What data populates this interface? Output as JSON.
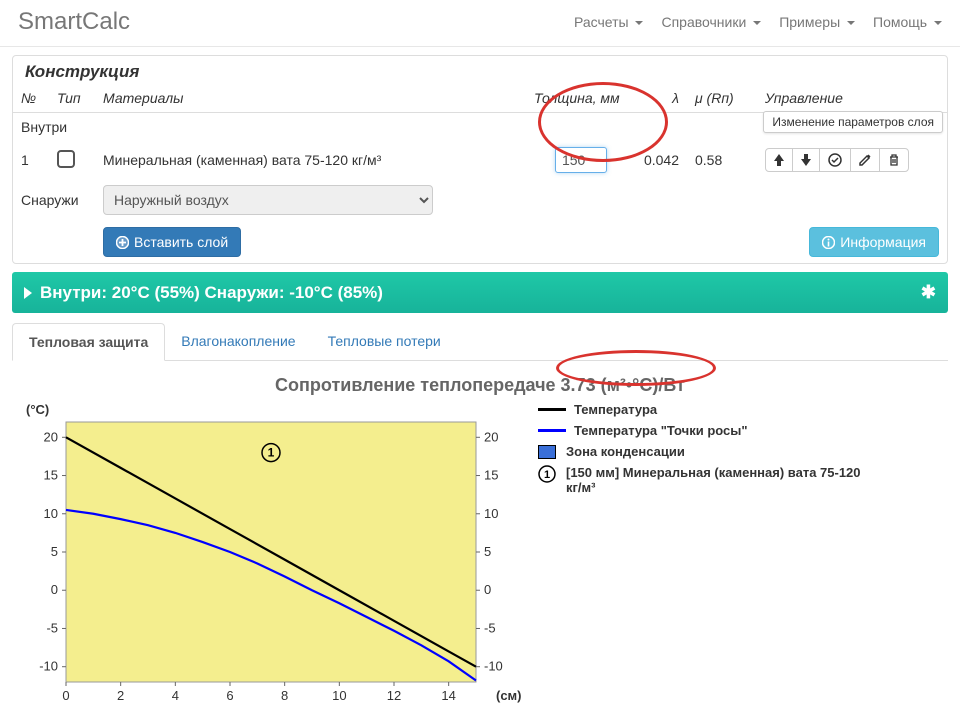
{
  "brand": "SmartCalc",
  "nav": {
    "calc": "Расчеты",
    "ref": "Справочники",
    "ex": "Примеры",
    "help": "Помощь"
  },
  "section_title": "Конструкция",
  "columns": {
    "no": "№",
    "type": "Тип",
    "materials": "Материалы",
    "thickness": "Толщина, мм",
    "lambda": "λ",
    "mu": "μ (Rп)",
    "ctrl": "Управление"
  },
  "inner_label": "Внутри",
  "outer_label": "Снаружи",
  "row1": {
    "no": "1",
    "material": "Минеральная (каменная) вата 75-120 кг/м³",
    "thickness": "150",
    "lambda": "0.042",
    "mu": "0.58"
  },
  "outer_select": "Наружный воздух",
  "btn_insert": "Вставить слой",
  "btn_info": "Информация",
  "tooltip_change": "Изменение параметров слоя",
  "env_text": "Внутри: 20°C (55%) Снаружи: -10°C (85%)",
  "tabs": {
    "t1": "Тепловая защита",
    "t2": "Влагонакопление",
    "t3": "Тепловые потери"
  },
  "chart_title_prefix": "Сопротивление теплопередаче ",
  "chart_title_value": "3.73 (м²•°C)/Вт",
  "axis_y_label": "(°C)",
  "axis_x_label": "(см)",
  "legend": {
    "temp": "Температура",
    "dew": "Температура \"Точки росы\"",
    "cond": "Зона конденсации",
    "layer1": "[150 мм] Минеральная (каменная) вата 75-120 кг/м³"
  },
  "chart_data": {
    "type": "line",
    "xlabel": "(см)",
    "ylabel": "(°C)",
    "xlim": [
      0,
      15
    ],
    "ylim": [
      -12,
      22
    ],
    "x_ticks": [
      0,
      2,
      4,
      6,
      8,
      10,
      12,
      14
    ],
    "y_ticks": [
      -10,
      -5,
      0,
      5,
      10,
      15,
      20
    ],
    "series": [
      {
        "name": "Температура",
        "color": "#000000",
        "x": [
          0,
          2,
          4,
          6,
          8,
          10,
          12,
          14,
          15
        ],
        "y": [
          20,
          16,
          12,
          8,
          4,
          0,
          -4,
          -8,
          -10
        ]
      },
      {
        "name": "Температура \"Точки росы\"",
        "color": "#0000ff",
        "x": [
          0,
          1,
          2,
          3,
          4,
          5,
          6,
          7,
          8,
          9,
          10,
          11,
          12,
          13,
          14,
          15
        ],
        "y": [
          10.5,
          10,
          9.3,
          8.5,
          7.5,
          6.3,
          5,
          3.5,
          1.8,
          0,
          -1.7,
          -3.5,
          -5.3,
          -7.2,
          -9.3,
          -11.8
        ]
      }
    ],
    "layer_region": {
      "x0": 0,
      "x1": 15,
      "fill": "#f4ee8e"
    }
  }
}
